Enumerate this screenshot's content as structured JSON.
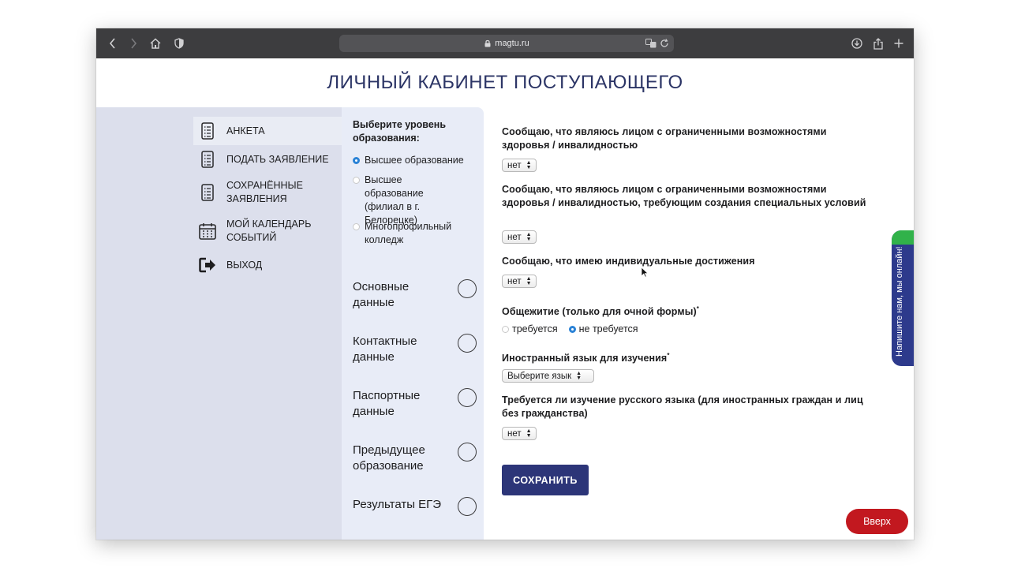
{
  "browser": {
    "url": "magtu.ru"
  },
  "page": {
    "title": "ЛИЧНЫЙ КАБИНЕТ ПОСТУПАЮЩЕГО"
  },
  "sidebar": {
    "items": [
      {
        "label": "АНКЕТА",
        "icon": "document-list-icon"
      },
      {
        "label": "ПОДАТЬ ЗАЯВЛЕНИЕ",
        "icon": "document-list-icon"
      },
      {
        "label": "СОХРАНЁННЫЕ ЗАЯВЛЕНИЯ",
        "icon": "document-list-icon"
      },
      {
        "label": "МОЙ КАЛЕНДАРЬ СОБЫТИЙ",
        "icon": "calendar-icon"
      },
      {
        "label": "ВЫХОД",
        "icon": "logout-icon"
      }
    ]
  },
  "education": {
    "heading": "Выберите уровень образования:",
    "options": [
      {
        "label": "Высшее образование",
        "checked": true
      },
      {
        "label": "Высшее образование (филиал в г. Белорецке)",
        "checked": false
      },
      {
        "label": "Многопрофильный колледж",
        "checked": false
      }
    ],
    "sections": [
      {
        "label": "Основные данные"
      },
      {
        "label": "Контактные данные"
      },
      {
        "label": "Паспортные данные"
      },
      {
        "label": "Предыдущее образование"
      },
      {
        "label": "Результаты ЕГЭ"
      }
    ]
  },
  "form": {
    "q1": {
      "label": "Сообщаю, что являюсь лицом с ограниченными возможностями здоровья / инвалидностью",
      "value": "нет"
    },
    "q2": {
      "label": "Сообщаю, что являюсь лицом с ограниченными возможностями здоровья / инвалидностью, требующим создания специальных условий",
      "value": "нет"
    },
    "q3": {
      "label": "Сообщаю, что имею индивидуальные достижения",
      "value": "нет"
    },
    "dorm": {
      "label": "Общежитие (только для очной формы)",
      "required_mark": "*",
      "options": [
        {
          "label": "требуется",
          "checked": false
        },
        {
          "label": "не требуется",
          "checked": true
        }
      ]
    },
    "language": {
      "label": "Иностранный язык для изучения",
      "required_mark": "*",
      "value": "Выберите язык"
    },
    "russian": {
      "label": "Требуется ли изучение русского языка (для иностранных граждан и лиц без гражданства)",
      "value": "нет"
    },
    "save_label": "СОХРАНИТЬ"
  },
  "chat_widget": {
    "label": "Напишите нам, мы онлайн!"
  },
  "scroll_top": {
    "label": "Вверх"
  },
  "colors": {
    "brand_navy": "#2c3578",
    "chat_green": "#31b24a",
    "scroll_red": "#c2181f",
    "radio_blue": "#2a82d6"
  }
}
